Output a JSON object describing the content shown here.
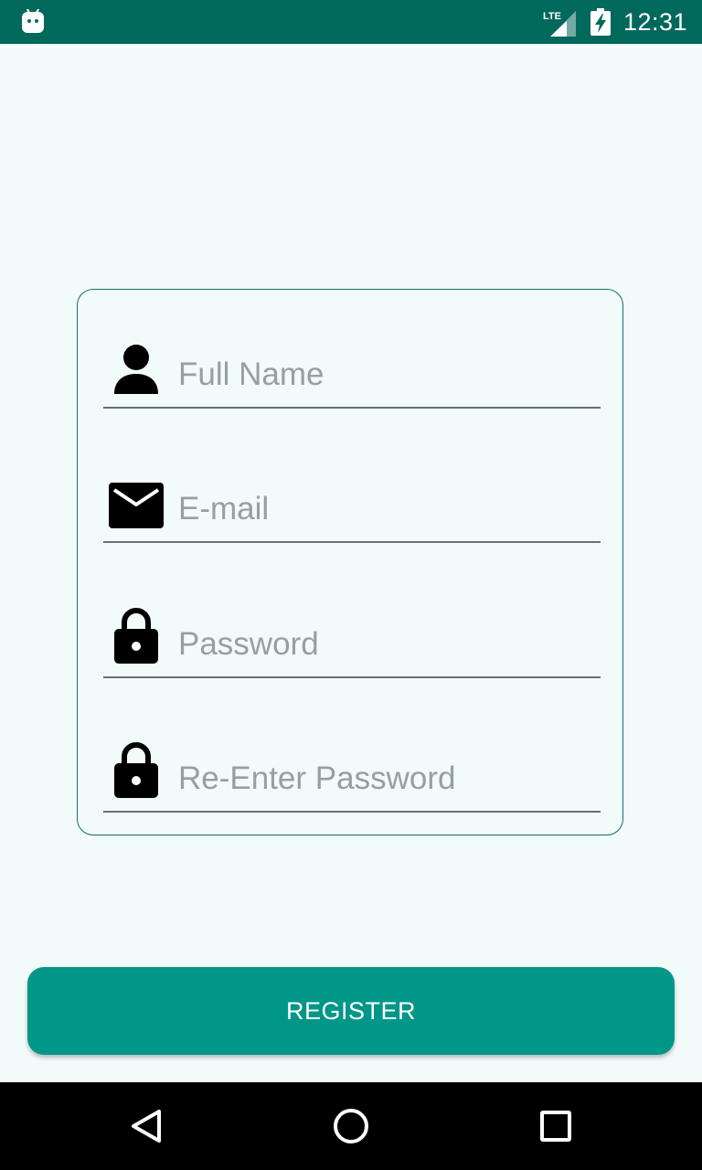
{
  "status_bar": {
    "time": "12:31",
    "network": "LTE",
    "icons": [
      "android-icon",
      "lte-signal-icon",
      "battery-charging-icon"
    ]
  },
  "form": {
    "fields": [
      {
        "name": "full-name",
        "icon": "person-icon",
        "placeholder": "Full Name",
        "value": ""
      },
      {
        "name": "email",
        "icon": "email-icon",
        "placeholder": "E-mail",
        "value": ""
      },
      {
        "name": "password",
        "icon": "lock-icon",
        "placeholder": "Password",
        "value": ""
      },
      {
        "name": "reenter-password",
        "icon": "lock-icon",
        "placeholder": "Re-Enter Password",
        "value": ""
      }
    ]
  },
  "register_button": {
    "label": "REGISTER"
  },
  "nav_bar": {
    "buttons": [
      "back-icon",
      "home-icon",
      "recents-icon"
    ]
  },
  "colors": {
    "status_bar": "#00695C",
    "accent": "#009688",
    "background": "#F1FBF9",
    "card_border": "#1B6D66",
    "placeholder": "#9A9E9E"
  }
}
